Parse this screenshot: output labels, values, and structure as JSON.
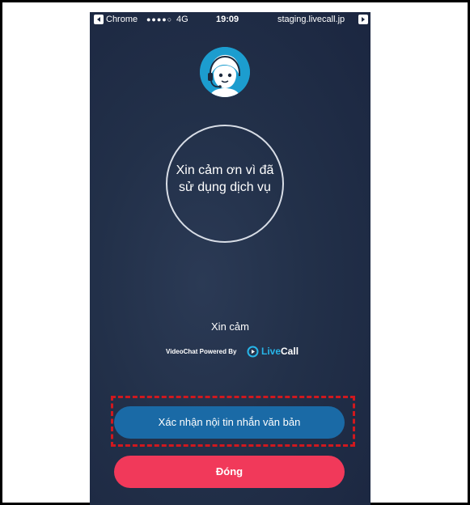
{
  "status_bar": {
    "carrier": "Chrome",
    "signal": "●●●●○",
    "network": "4G",
    "time": "19:09",
    "url": "staging.livecall.jp"
  },
  "thank_you_message": "Xin cảm ơn vì đã sử dụng dịch vụ",
  "caption": "Xin cảm",
  "powered_by": {
    "text": "VideoChat Powered By",
    "brand_prefix": "Live",
    "brand_suffix": "Call"
  },
  "buttons": {
    "confirm_label": "Xác nhận nội tin nhắn văn bản",
    "close_label": "Đóng"
  },
  "colors": {
    "background": "#223049",
    "avatar": "#1c9dcf",
    "confirm_button": "#1a6aa6",
    "close_button": "#f1395a",
    "brand_accent": "#27b5e8",
    "highlight": "#d0181e"
  }
}
